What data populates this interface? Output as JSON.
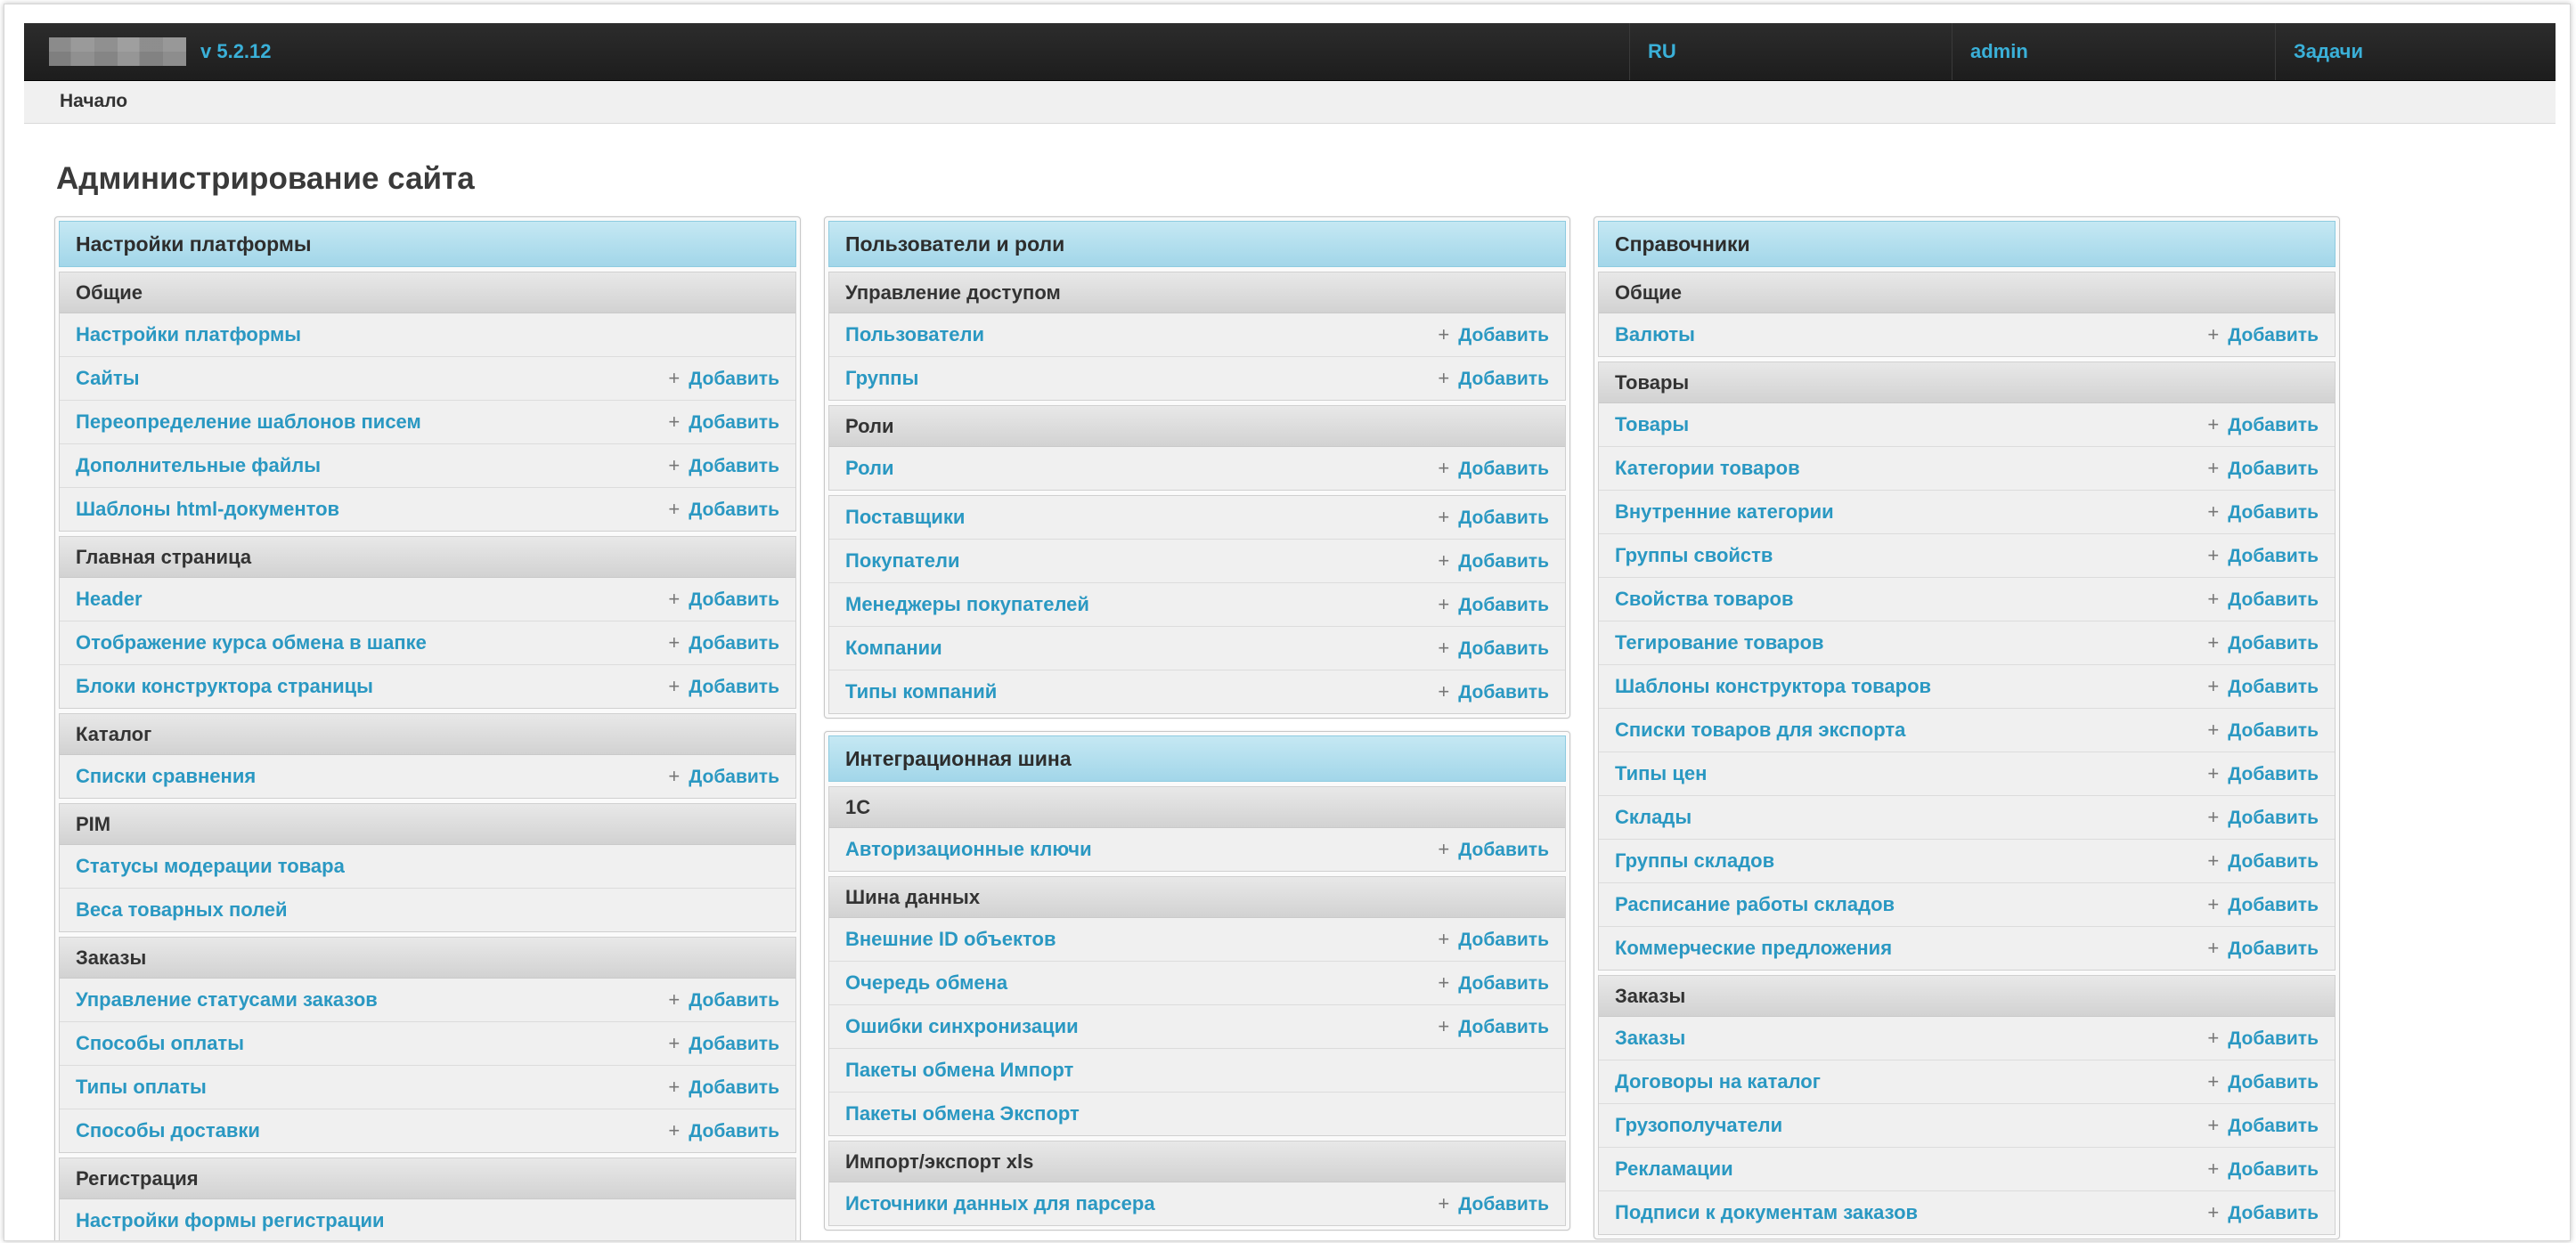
{
  "topbar": {
    "version": "v 5.2.12",
    "lang": "RU",
    "user": "admin",
    "tasks": "Задачи"
  },
  "breadcrumb": "Начало",
  "page_title": "Администрирование сайта",
  "add_label": "Добавить",
  "columns": [
    {
      "panels": [
        {
          "title": "Настройки платформы",
          "sections": [
            {
              "title": "Общие",
              "items": [
                {
                  "label": "Настройки платформы",
                  "add": false
                },
                {
                  "label": "Сайты",
                  "add": true
                },
                {
                  "label": "Переопределение шаблонов писем",
                  "add": true
                },
                {
                  "label": "Дополнительные файлы",
                  "add": true
                },
                {
                  "label": "Шаблоны html-документов",
                  "add": true
                }
              ]
            },
            {
              "title": "Главная страница",
              "items": [
                {
                  "label": "Header",
                  "add": true
                },
                {
                  "label": "Отображение курса обмена в шапке",
                  "add": true
                },
                {
                  "label": "Блоки конструктора страницы",
                  "add": true
                }
              ]
            },
            {
              "title": "Каталог",
              "items": [
                {
                  "label": "Списки сравнения",
                  "add": true
                }
              ]
            },
            {
              "title": "PIM",
              "items": [
                {
                  "label": "Статусы модерации товара",
                  "add": false
                },
                {
                  "label": "Веса товарных полей",
                  "add": false
                }
              ]
            },
            {
              "title": "Заказы",
              "items": [
                {
                  "label": "Управление статусами заказов",
                  "add": true
                },
                {
                  "label": "Способы оплаты",
                  "add": true
                },
                {
                  "label": "Типы оплаты",
                  "add": true
                },
                {
                  "label": "Способы доставки",
                  "add": true
                }
              ]
            },
            {
              "title": "Регистрация",
              "items": [
                {
                  "label": "Настройки формы регистрации",
                  "add": false
                }
              ]
            }
          ]
        }
      ]
    },
    {
      "panels": [
        {
          "title": "Пользователи и роли",
          "sections": [
            {
              "title": "Управление доступом",
              "items": [
                {
                  "label": "Пользователи",
                  "add": true
                },
                {
                  "label": "Группы",
                  "add": true
                }
              ]
            },
            {
              "title": "Роли",
              "items": [
                {
                  "label": "Роли",
                  "add": true
                }
              ]
            },
            {
              "title": "",
              "items": [
                {
                  "label": "Поставщики",
                  "add": true
                },
                {
                  "label": "Покупатели",
                  "add": true
                },
                {
                  "label": "Менеджеры покупателей",
                  "add": true
                },
                {
                  "label": "Компании",
                  "add": true
                },
                {
                  "label": "Типы компаний",
                  "add": true
                }
              ]
            }
          ]
        },
        {
          "title": "Интеграционная шина",
          "sections": [
            {
              "title": "1С",
              "items": [
                {
                  "label": "Авторизационные ключи",
                  "add": true
                }
              ]
            },
            {
              "title": "Шина данных",
              "items": [
                {
                  "label": "Внешние ID объектов",
                  "add": true
                },
                {
                  "label": "Очередь обмена",
                  "add": true
                },
                {
                  "label": "Ошибки синхронизации",
                  "add": true
                },
                {
                  "label": "Пакеты обмена Импорт",
                  "add": false
                },
                {
                  "label": "Пакеты обмена Экспорт",
                  "add": false
                }
              ]
            },
            {
              "title": "Импорт/экспорт xls",
              "items": [
                {
                  "label": "Источники данных для парсера",
                  "add": true
                }
              ]
            }
          ]
        }
      ]
    },
    {
      "panels": [
        {
          "title": "Справочники",
          "sections": [
            {
              "title": "Общие",
              "items": [
                {
                  "label": "Валюты",
                  "add": true
                }
              ]
            },
            {
              "title": "Товары",
              "items": [
                {
                  "label": "Товары",
                  "add": true
                },
                {
                  "label": "Категории товаров",
                  "add": true
                },
                {
                  "label": "Внутренние категории",
                  "add": true
                },
                {
                  "label": "Группы свойств",
                  "add": true
                },
                {
                  "label": "Свойства товаров",
                  "add": true
                },
                {
                  "label": "Тегирование товаров",
                  "add": true
                },
                {
                  "label": "Шаблоны конструктора товаров",
                  "add": true
                },
                {
                  "label": "Списки товаров для экспорта",
                  "add": true
                },
                {
                  "label": "Типы цен",
                  "add": true
                },
                {
                  "label": "Склады",
                  "add": true
                },
                {
                  "label": "Группы складов",
                  "add": true
                },
                {
                  "label": "Расписание работы складов",
                  "add": true
                },
                {
                  "label": "Коммерческие предложения",
                  "add": true
                }
              ]
            },
            {
              "title": "Заказы",
              "items": [
                {
                  "label": "Заказы",
                  "add": true
                },
                {
                  "label": "Договоры на каталог",
                  "add": true
                },
                {
                  "label": "Грузополучатели",
                  "add": true
                },
                {
                  "label": "Рекламации",
                  "add": true
                },
                {
                  "label": "Подписи к документам заказов",
                  "add": true
                }
              ]
            }
          ]
        }
      ]
    }
  ]
}
